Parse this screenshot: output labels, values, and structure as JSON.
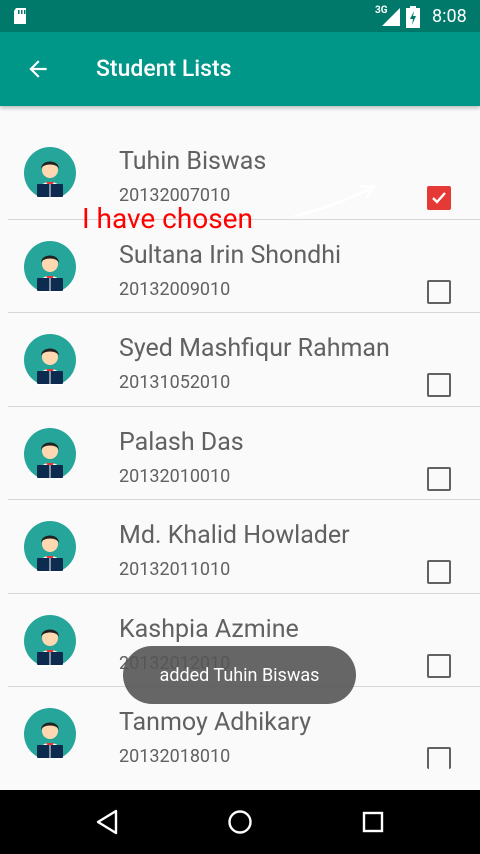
{
  "status_bar": {
    "network": "3G",
    "time": "8:08"
  },
  "app_bar": {
    "title": "Student Lists",
    "back_icon": "arrow-back-icon"
  },
  "students": [
    {
      "name": "Tuhin Biswas",
      "id": "20132007010",
      "checked": true
    },
    {
      "name": "Sultana Irin Shondhi",
      "id": "20132009010",
      "checked": false
    },
    {
      "name": "Syed Mashfiqur Rahman",
      "id": "20131052010",
      "checked": false
    },
    {
      "name": "Palash Das",
      "id": "20132010010",
      "checked": false
    },
    {
      "name": "Md. Khalid Howlader",
      "id": "20132011010",
      "checked": false
    },
    {
      "name": "Kashpia Azmine",
      "id": "20132012010",
      "checked": false
    },
    {
      "name": "Tanmoy Adhikary",
      "id": "20132018010",
      "checked": false
    }
  ],
  "annotation": "I have chosen",
  "toast": "added Tuhin Biswas",
  "colors": {
    "primary": "#009688",
    "primary_dark": "#00796b",
    "check_accent": "#e53935"
  }
}
